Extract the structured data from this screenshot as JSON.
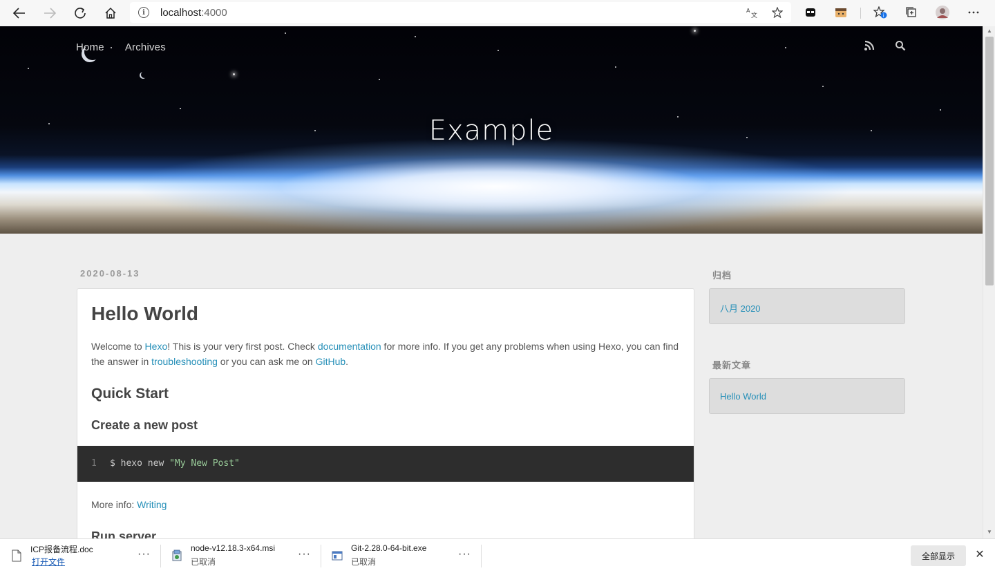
{
  "browser": {
    "url_host": "localhost",
    "url_port": ":4000"
  },
  "site": {
    "nav": {
      "home": "Home",
      "archives": "Archives"
    },
    "title": "Example"
  },
  "post": {
    "date": "2020-08-13",
    "title": "Hello World",
    "intro_1": "Welcome to ",
    "link_hexo": "Hexo",
    "intro_2": "! This is your very first post. Check ",
    "link_docs": "documentation",
    "intro_3": " for more info. If you get any problems when using Hexo, you can find the answer in ",
    "link_trouble": "troubleshooting",
    "intro_4": " or you can ask me on ",
    "link_github": "GitHub",
    "intro_5": ".",
    "h_quick_start": "Quick Start",
    "h_create_post": "Create a new post",
    "code_line_no": "1",
    "code_cmd": "$ hexo new ",
    "code_str": "\"My New Post\"",
    "more_info_label": "More info: ",
    "more_info_link": "Writing",
    "h_run_server": "Run server"
  },
  "sidebar": {
    "archive_title": "归档",
    "archive_item": "八月 2020",
    "recent_title": "最新文章",
    "recent_item": "Hello World"
  },
  "downloads": {
    "items": [
      {
        "name": "ICP报备流程.doc",
        "status": "打开文件"
      },
      {
        "name": "node-v12.18.3-x64.msi",
        "status": "已取消"
      },
      {
        "name": "Git-2.28.0-64-bit.exe",
        "status": "已取消"
      }
    ],
    "more_label": "···",
    "show_all": "全部显示",
    "close_label": "✕"
  },
  "colors": {
    "link": "#258fb8",
    "code_bg": "#2d2d2d",
    "page_bg": "#eeeeee"
  }
}
